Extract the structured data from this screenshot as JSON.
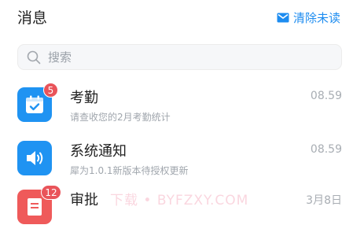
{
  "header": {
    "title": "消息",
    "clear_label": "清除未读"
  },
  "search": {
    "placeholder": "搜索"
  },
  "messages": [
    {
      "title": "考勤",
      "subtitle": "请查收您的2月考勤统计",
      "time": "08.59",
      "badge": "5",
      "icon": "calendar-check-icon",
      "color": "#1f93f2"
    },
    {
      "title": "系统通知",
      "subtitle": "犀为1.0.1新版本待授权更新",
      "time": "08.59",
      "badge": "",
      "icon": "speaker-icon",
      "color": "#1f93f2"
    },
    {
      "title": "审批",
      "subtitle": "",
      "time": "3月8日",
      "badge": "12",
      "icon": "document-icon",
      "color": "#ef5a5a"
    }
  ],
  "watermark": "下载 • BYFZXY.COM"
}
